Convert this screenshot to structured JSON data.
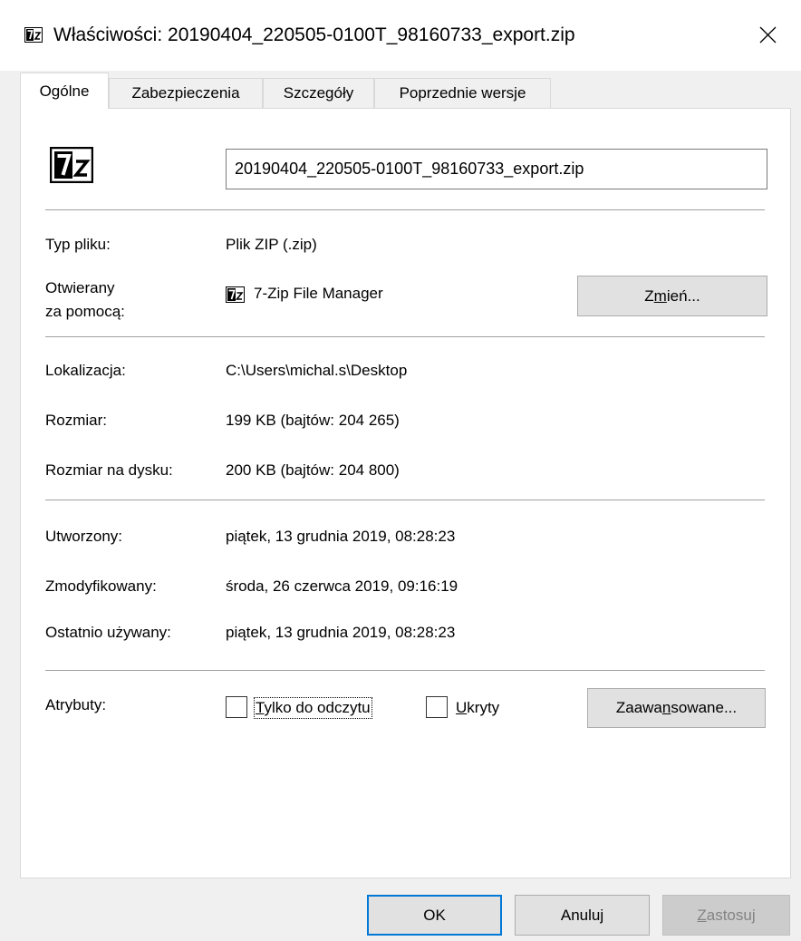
{
  "window": {
    "title": "Właściwości: 20190404_220505-0100T_98160733_export.zip"
  },
  "tabs": [
    {
      "label": "Ogólne",
      "active": true
    },
    {
      "label": "Zabezpieczenia",
      "active": false
    },
    {
      "label": "Szczegóły",
      "active": false
    },
    {
      "label": "Poprzednie wersje",
      "active": false
    }
  ],
  "general": {
    "file_name": "20190404_220505-0100T_98160733_export.zip",
    "file_type_label": "Typ pliku:",
    "file_type_value": "Plik ZIP (.zip)",
    "opens_with_label_line1": "Otwierany",
    "opens_with_label_line2": "za pomocą:",
    "opens_with_value": "7-Zip File Manager",
    "change_button": {
      "pre": "Z",
      "u": "m",
      "post": "ień..."
    },
    "location_label": "Lokalizacja:",
    "location_value": "C:\\Users\\michal.s\\Desktop",
    "size_label": "Rozmiar:",
    "size_value": "199 KB (bajtów: 204 265)",
    "size_on_disk_label": "Rozmiar na dysku:",
    "size_on_disk_value": "200 KB (bajtów: 204 800)",
    "created_label": "Utworzony:",
    "created_value": "piątek, 13 grudnia 2019, 08:28:23",
    "modified_label": "Zmodyfikowany:",
    "modified_value": "środa, 26 czerwca 2019, 09:16:19",
    "accessed_label": "Ostatnio używany:",
    "accessed_value": "piątek, 13 grudnia 2019, 08:28:23",
    "attributes_label": "Atrybuty:",
    "readonly": {
      "u": "T",
      "rest": "ylko do odczytu",
      "checked": false
    },
    "hidden": {
      "u": "U",
      "rest": "kryty",
      "checked": false
    },
    "advanced_button": {
      "pre": "Zaawa",
      "u": "n",
      "post": "sowane..."
    }
  },
  "footer": {
    "ok": "OK",
    "cancel": "Anuluj",
    "apply": {
      "u": "Z",
      "rest": "astosuj"
    }
  },
  "icons": {
    "title": "7zip-icon",
    "big": "7zip-icon",
    "app": "7zip-icon",
    "close": "close-icon"
  },
  "colors": {
    "focus_border": "#0078d7",
    "panel": "#ffffff",
    "dialog": "#f0f0f0",
    "button": "#e1e1e1"
  }
}
